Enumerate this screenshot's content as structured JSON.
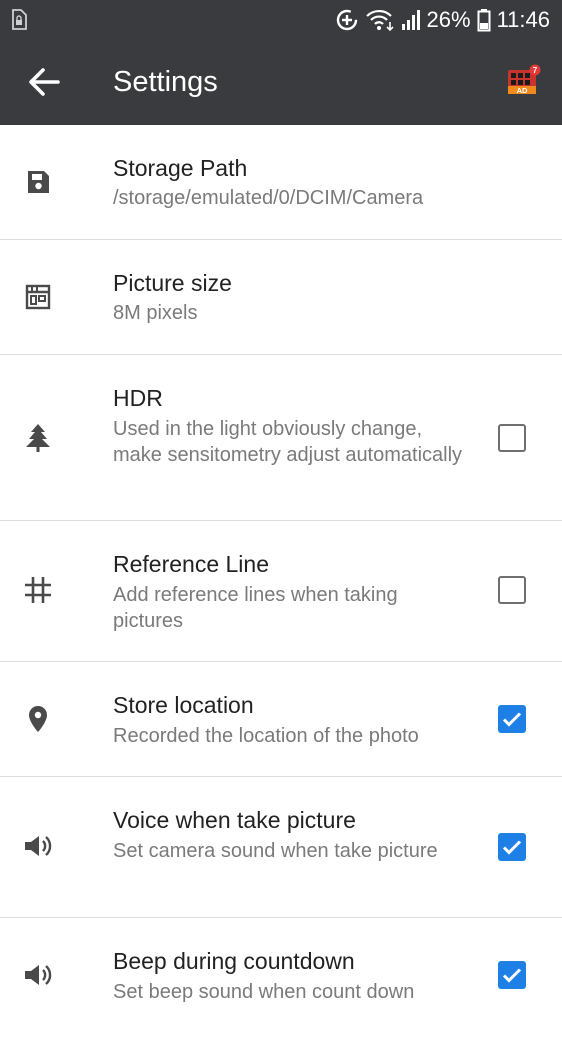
{
  "status_bar": {
    "battery": "26%",
    "time": "11:46"
  },
  "app_bar": {
    "title": "Settings",
    "ad_label": "AD",
    "ad_badge": "7"
  },
  "settings": [
    {
      "title": "Storage Path",
      "subtitle": "/storage/emulated/0/DCIM/Camera",
      "icon": "save-icon"
    },
    {
      "title": "Picture size",
      "subtitle": "8M pixels",
      "icon": "picture-size-icon"
    },
    {
      "title": "HDR",
      "subtitle": "Used in the light obviously change, make sensitometry adjust automatically",
      "icon": "hdr-tree-icon",
      "checked": false
    },
    {
      "title": "Reference Line",
      "subtitle": "Add reference lines when taking pictures",
      "icon": "grid-icon",
      "checked": false
    },
    {
      "title": "Store location",
      "subtitle": "Recorded the location of the photo",
      "icon": "location-pin-icon",
      "checked": true
    },
    {
      "title": "Voice when take picture",
      "subtitle": "Set camera sound when take picture",
      "icon": "volume-icon",
      "checked": true
    },
    {
      "title": "Beep during countdown",
      "subtitle": "Set beep sound when count down",
      "icon": "volume-icon",
      "checked": true
    }
  ],
  "colors": {
    "bar_background": "#393b3e",
    "accent": "#1e7fe6",
    "title_text": "#222222",
    "subtitle_text": "#7a7a7a",
    "divider": "#dddddd"
  }
}
